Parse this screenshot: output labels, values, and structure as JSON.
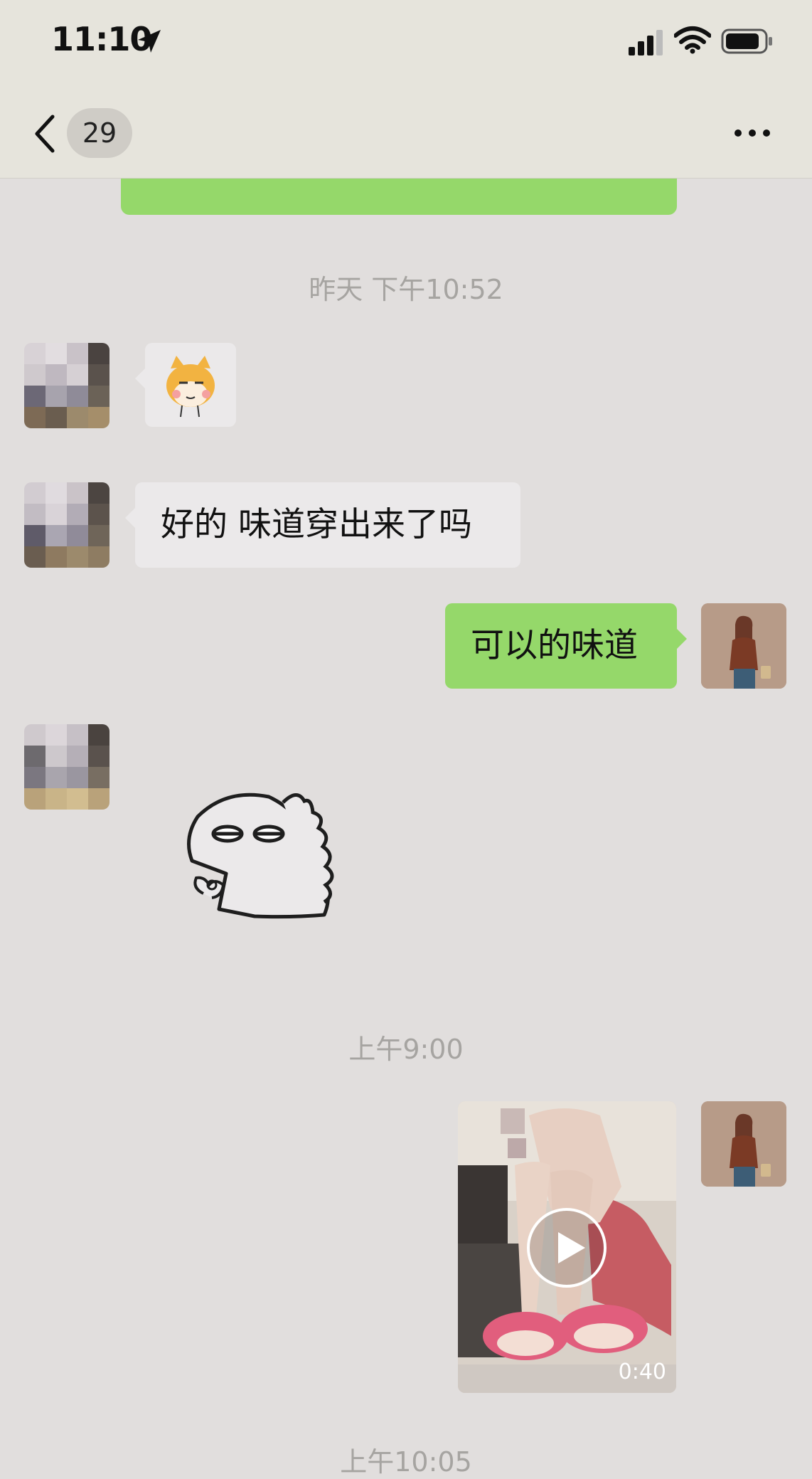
{
  "status_bar": {
    "time": "11:10"
  },
  "header": {
    "unread_count": "29",
    "title": ""
  },
  "messages": {
    "partial_top_text": "",
    "timestamp_1": "昨天 下午10:52",
    "text_left_1": "好的 味道穿出来了吗",
    "text_right_1": "可以的味道",
    "timestamp_2": "上午9:00",
    "video_duration": "0:40",
    "timestamp_3": "上午10:05"
  },
  "colors": {
    "background": "#e1dedd",
    "sent_bubble": "#95d86a",
    "received_bubble": "#ebe9ea",
    "timestamp_text": "#a6a4a1"
  },
  "icons": [
    "location-arrow-icon",
    "signal-icon",
    "wifi-icon",
    "battery-icon",
    "back-chevron-icon",
    "more-icon",
    "play-icon"
  ]
}
